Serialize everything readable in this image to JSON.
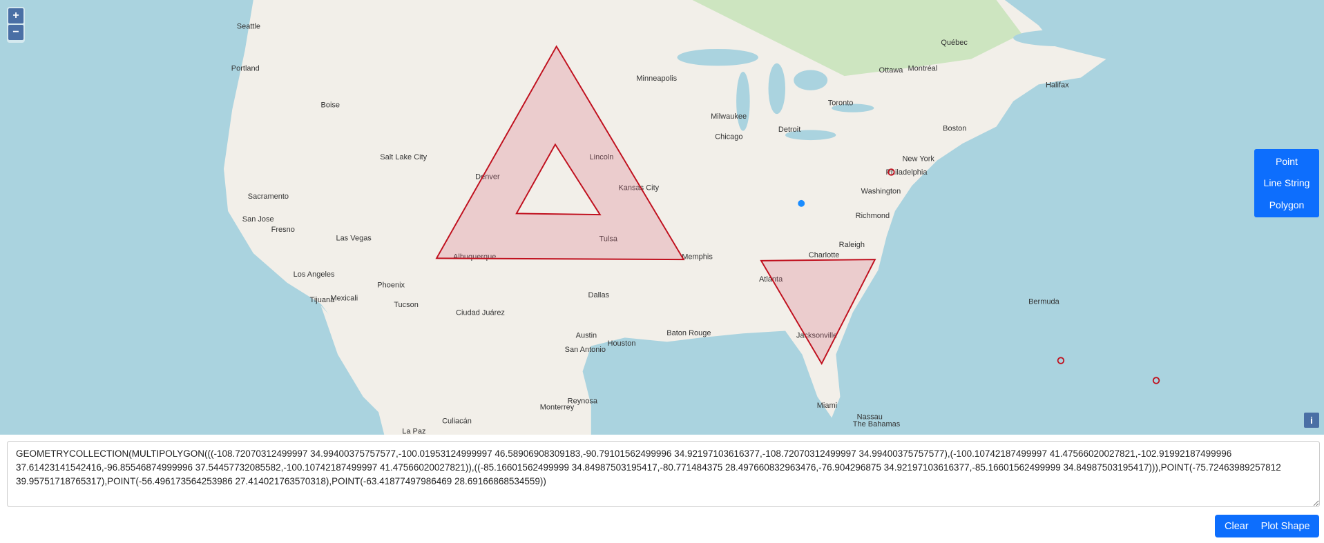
{
  "map": {
    "zoom_in_label": "+",
    "zoom_out_label": "−",
    "info_label": "i",
    "cities": [
      {
        "name": "Seattle",
        "lon": -122.3,
        "lat": 47.6
      },
      {
        "name": "Portland",
        "lon": -122.7,
        "lat": 45.5
      },
      {
        "name": "Boise",
        "lon": -116.2,
        "lat": 43.6
      },
      {
        "name": "Sacramento",
        "lon": -121.5,
        "lat": 38.6
      },
      {
        "name": "San Jose",
        "lon": -121.9,
        "lat": 37.3
      },
      {
        "name": "Fresno",
        "lon": -119.8,
        "lat": 36.7
      },
      {
        "name": "Las Vegas",
        "lon": -115.1,
        "lat": 36.2
      },
      {
        "name": "Los Angeles",
        "lon": -118.2,
        "lat": 34.05
      },
      {
        "name": "Tijuana",
        "lon": -117.0,
        "lat": 32.5
      },
      {
        "name": "Mexicali",
        "lon": -115.5,
        "lat": 32.6
      },
      {
        "name": "Phoenix",
        "lon": -112.1,
        "lat": 33.4
      },
      {
        "name": "Tucson",
        "lon": -110.9,
        "lat": 32.2
      },
      {
        "name": "Salt Lake City",
        "lon": -111.9,
        "lat": 40.8
      },
      {
        "name": "Denver",
        "lon": -104.99,
        "lat": 39.7
      },
      {
        "name": "Albuquerque",
        "lon": -106.6,
        "lat": 35.1
      },
      {
        "name": "Ciudad Juárez",
        "lon": -106.4,
        "lat": 31.7
      },
      {
        "name": "Lincoln",
        "lon": -96.7,
        "lat": 40.8
      },
      {
        "name": "Kansas City",
        "lon": -94.6,
        "lat": 39.1
      },
      {
        "name": "Tulsa",
        "lon": -96.0,
        "lat": 36.15
      },
      {
        "name": "Dallas",
        "lon": -96.8,
        "lat": 32.8
      },
      {
        "name": "Austin",
        "lon": -97.7,
        "lat": 30.3
      },
      {
        "name": "San Antonio",
        "lon": -98.5,
        "lat": 29.4
      },
      {
        "name": "Houston",
        "lon": -95.4,
        "lat": 29.8
      },
      {
        "name": "Memphis",
        "lon": -90.0,
        "lat": 35.1
      },
      {
        "name": "Baton Rouge",
        "lon": -91.1,
        "lat": 30.45
      },
      {
        "name": "Minneapolis",
        "lon": -93.3,
        "lat": 44.98
      },
      {
        "name": "Milwaukee",
        "lon": -87.9,
        "lat": 43.0
      },
      {
        "name": "Chicago",
        "lon": -87.6,
        "lat": 41.9
      },
      {
        "name": "Detroit",
        "lon": -83.0,
        "lat": 42.3
      },
      {
        "name": "Toronto",
        "lon": -79.4,
        "lat": 43.7
      },
      {
        "name": "Ottawa",
        "lon": -75.7,
        "lat": 45.4
      },
      {
        "name": "Montréal",
        "lon": -73.6,
        "lat": 45.5
      },
      {
        "name": "Québec",
        "lon": -71.2,
        "lat": 46.8
      },
      {
        "name": "Boston",
        "lon": -71.06,
        "lat": 42.36
      },
      {
        "name": "New York",
        "lon": -74.0,
        "lat": 40.7
      },
      {
        "name": "Philadelphia",
        "lon": -75.2,
        "lat": 39.95
      },
      {
        "name": "Washington",
        "lon": -77.0,
        "lat": 38.9
      },
      {
        "name": "Richmond",
        "lon": -77.4,
        "lat": 37.5
      },
      {
        "name": "Raleigh",
        "lon": -78.6,
        "lat": 35.8
      },
      {
        "name": "Charlotte",
        "lon": -80.8,
        "lat": 35.2
      },
      {
        "name": "Atlanta",
        "lon": -84.4,
        "lat": 33.75
      },
      {
        "name": "Jacksonville",
        "lon": -81.7,
        "lat": 30.3
      },
      {
        "name": "Miami",
        "lon": -80.2,
        "lat": 25.8
      },
      {
        "name": "Nassau",
        "lon": -77.3,
        "lat": 25.05
      },
      {
        "name": "Halifax",
        "lon": -63.6,
        "lat": 44.65
      },
      {
        "name": "Monterrey",
        "lon": -100.3,
        "lat": 25.7
      },
      {
        "name": "Reynosa",
        "lon": -98.3,
        "lat": 26.1
      },
      {
        "name": "Culiacán",
        "lon": -107.4,
        "lat": 24.8
      },
      {
        "name": "La Paz",
        "lon": -110.3,
        "lat": 24.1
      }
    ],
    "water_labels": [
      "Bermuda",
      "The Bahamas"
    ],
    "colors": {
      "water": "#aad3df",
      "land": "#f2efe9",
      "shape_stroke": "#c0101e",
      "shape_fill": "#d9637a",
      "point_blue": "#1a8cff"
    }
  },
  "controls": {
    "point_label": "Point",
    "linestring_label": "Line String",
    "polygon_label": "Polygon"
  },
  "wkt": {
    "value": "GEOMETRYCOLLECTION(MULTIPOLYGON(((-108.72070312499997 34.99400375757577,-100.01953124999997 46.58906908309183,-90.79101562499996 34.92197103616377,-108.72070312499997 34.99400375757577),(-100.10742187499997 41.47566020027821,-102.91992187499996 37.61423141542416,-96.85546874999996 37.54457732085582,-100.10742187499997 41.47566020027821)),((-85.16601562499999 34.84987503195417,-80.771484375 28.497660832963476,-76.904296875 34.92197103616377,-85.16601562499999 34.84987503195417))),POINT(-75.72463989257812 39.95751718765317),POINT(-56.496173564253986 27.414021763570318),POINT(-63.41877497986469 28.69166868534559))"
  },
  "actions": {
    "clear_label": "Clear",
    "plot_label": "Plot Shape"
  }
}
